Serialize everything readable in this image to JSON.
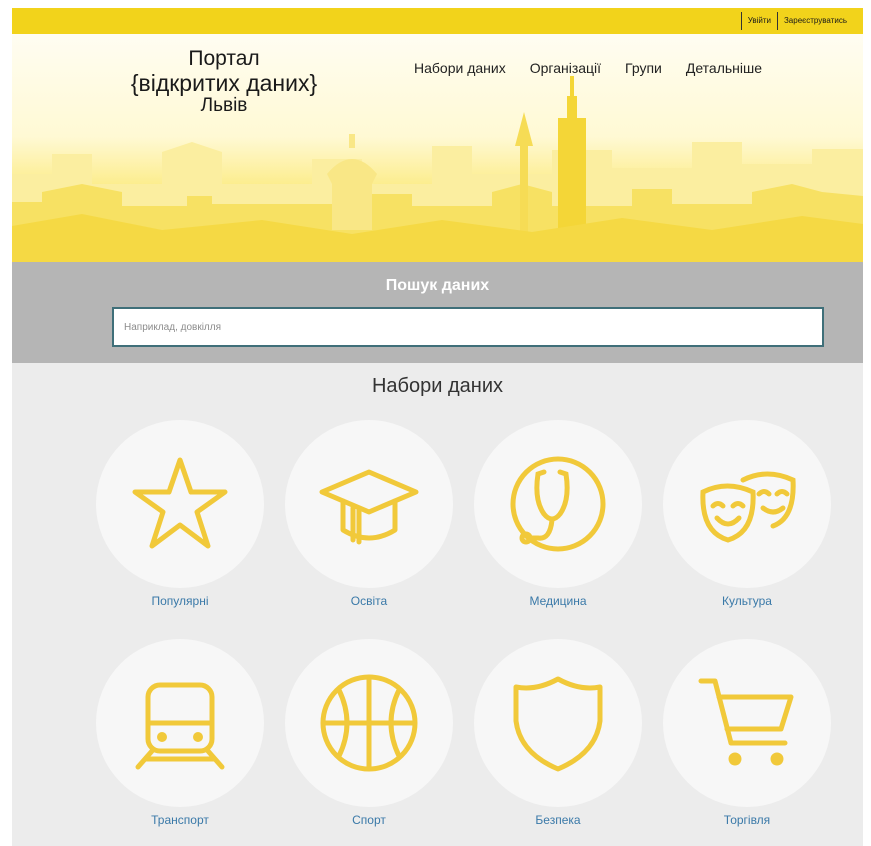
{
  "auth": {
    "login": "Увійти",
    "register": "Зареєструватись"
  },
  "logo": {
    "line1": "Портал",
    "line2": "{відкритих даних}",
    "line3": "Львів"
  },
  "nav": {
    "datasets": "Набори даних",
    "organizations": "Організації",
    "groups": "Групи",
    "more": "Детальніше"
  },
  "search": {
    "title": "Пошук даних",
    "placeholder": "Наприклад, довкілля"
  },
  "catalog": {
    "title": "Набори даних",
    "categories": [
      {
        "label": "Популярні",
        "icon": "star-icon"
      },
      {
        "label": "Освіта",
        "icon": "graduation-cap-icon"
      },
      {
        "label": "Медицина",
        "icon": "stethoscope-icon"
      },
      {
        "label": "Культура",
        "icon": "theater-masks-icon"
      },
      {
        "label": "Транспорт",
        "icon": "tram-icon"
      },
      {
        "label": "Спорт",
        "icon": "basketball-icon"
      },
      {
        "label": "Безпека",
        "icon": "shield-icon"
      },
      {
        "label": "Торгівля",
        "icon": "shopping-cart-icon"
      }
    ]
  },
  "colors": {
    "brand_yellow": "#f2d31b",
    "icon_yellow": "#f1c93a",
    "link_blue": "#3a79a8",
    "search_band": "#b5b5b5"
  }
}
